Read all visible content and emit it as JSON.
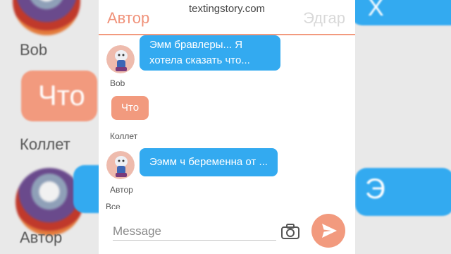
{
  "background": {
    "top_right_glyph": "Х",
    "label_1": "Bob",
    "bubble_text": "Что",
    "label_2": "Коллет",
    "label_3": "Автор",
    "blue_glyph": "Э"
  },
  "watermark": "textingstory.com",
  "header": {
    "left_name": "Автор",
    "right_name": "Эдгар"
  },
  "messages": [
    {
      "sender": "Bob",
      "text_line1": "Эмм бравлеры... Я",
      "text_line2": "хотела сказать что...",
      "color": "blue"
    },
    {
      "sender": "Коллет",
      "text": "Что",
      "color": "orange"
    },
    {
      "sender": "Автор",
      "text": "Ээмм ч беременна от ...",
      "color": "blue"
    }
  ],
  "next_sender_partial": "Все",
  "input": {
    "placeholder": "Message"
  },
  "icons": {
    "camera": "camera-icon",
    "send": "send-icon"
  },
  "colors": {
    "accent_orange": "#f29a7e",
    "bubble_blue": "#33aaf0",
    "header_inactive": "#d9d9d9"
  }
}
